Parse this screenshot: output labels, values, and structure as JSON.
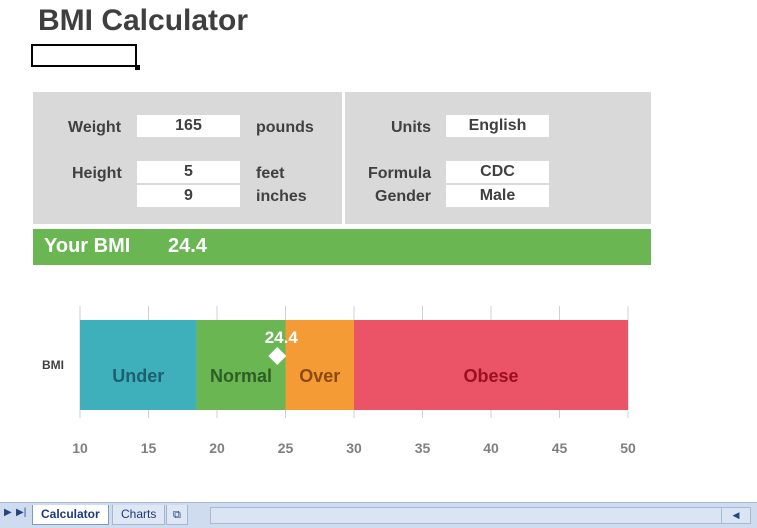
{
  "title": "BMI Calculator",
  "inputs": {
    "weight_label": "Weight",
    "weight_value": "165",
    "weight_unit": "pounds",
    "height_label": "Height",
    "height_feet_value": "5",
    "height_feet_unit": "feet",
    "height_inches_value": "9",
    "height_inches_unit": "inches",
    "units_label": "Units",
    "units_value": "English",
    "formula_label": "Formula",
    "formula_value": "CDC",
    "gender_label": "Gender",
    "gender_value": "Male"
  },
  "result": {
    "label": "Your BMI",
    "value": "24.4"
  },
  "chart_data": {
    "type": "bar",
    "category": "BMI",
    "xlim": [
      10,
      50
    ],
    "ticks": [
      10,
      15,
      20,
      25,
      30,
      35,
      40,
      45,
      50
    ],
    "segments": [
      {
        "name": "Under",
        "start": 10,
        "end": 18.5,
        "color": "#3eb0bb",
        "text_color": "#1d5f6f"
      },
      {
        "name": "Normal",
        "start": 18.5,
        "end": 25,
        "color": "#6ab652",
        "text_color": "#2e5e24"
      },
      {
        "name": "Over",
        "start": 25,
        "end": 30,
        "color": "#f59b35",
        "text_color": "#8a4a10"
      },
      {
        "name": "Obese",
        "start": 30,
        "end": 50,
        "color": "#ea5466",
        "text_color": "#9b1020"
      }
    ],
    "marker": {
      "value": 24.4,
      "label": "24.4"
    },
    "grid": true
  },
  "sheet_tabs": {
    "active": "Calculator",
    "inactive": "Charts"
  }
}
